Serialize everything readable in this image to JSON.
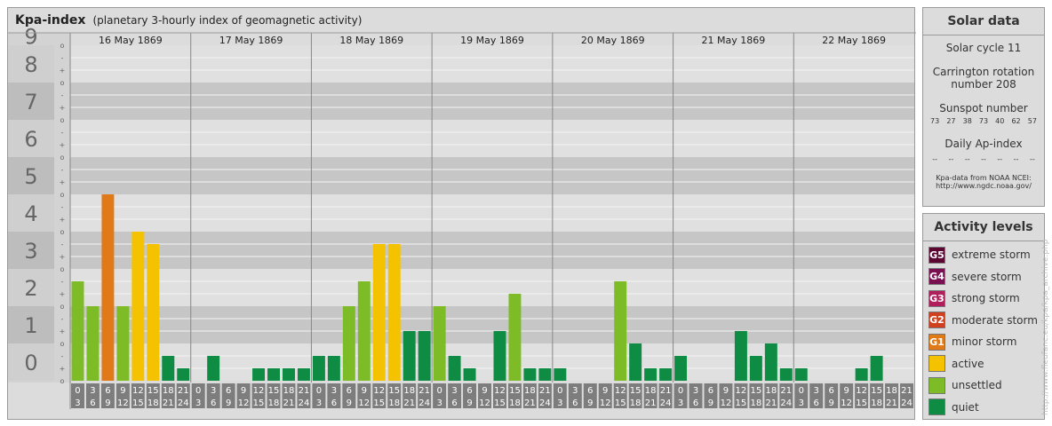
{
  "header": {
    "title": "Kpa-index",
    "subtitle": "(planetary 3-hourly index of geomagnetic activity)"
  },
  "chart_data": {
    "type": "bar",
    "title": "Kpa-index",
    "subtitle": "(planetary 3-hourly index of geomagnetic activity)",
    "ylim": [
      0,
      9
    ],
    "yticks": [
      "0",
      "1",
      "2",
      "3",
      "4",
      "5",
      "6",
      "7",
      "8",
      "9"
    ],
    "minor_ticks": [
      "o",
      "+",
      "-"
    ],
    "days": [
      "16 May 1869",
      "17 May 1869",
      "18 May 1869",
      "19 May 1869",
      "20 May 1869",
      "21 May 1869",
      "22 May 1869"
    ],
    "interval_labels": [
      [
        "0",
        "3"
      ],
      [
        "3",
        "6"
      ],
      [
        "6",
        "9"
      ],
      [
        "9",
        "12"
      ],
      [
        "12",
        "15"
      ],
      [
        "15",
        "18"
      ],
      [
        "18",
        "21"
      ],
      [
        "21",
        "24"
      ]
    ],
    "values": [
      [
        2.667,
        2,
        5,
        2,
        4,
        3.667,
        0.667,
        0.333
      ],
      [
        0,
        0.667,
        0,
        0,
        0.333,
        0.333,
        0.333,
        0.333
      ],
      [
        0.667,
        0.667,
        2,
        2.667,
        3.667,
        3.667,
        1.333,
        1.333
      ],
      [
        2,
        0.667,
        0.333,
        0,
        1.333,
        2.333,
        0.333,
        0.333
      ],
      [
        0.333,
        0,
        0,
        0,
        2.667,
        1,
        0.333,
        0.333
      ],
      [
        0.667,
        0,
        0,
        0,
        1.333,
        0.667,
        1,
        0.333
      ],
      [
        0.333,
        0,
        0,
        0,
        0.333,
        0.667,
        0,
        0
      ]
    ],
    "colors": {
      "quiet": "#0e8c43",
      "unsettled": "#7dbb27",
      "active": "#f5c200",
      "G1": "#e07a18",
      "G2": "#d0401e",
      "G3": "#b01e5c",
      "G4": "#7a0f52",
      "G5": "#5a0630"
    },
    "grid": true
  },
  "solar": {
    "title": "Solar data",
    "cycle": "Solar cycle 11",
    "carrington_line1": "Carrington rotation",
    "carrington_line2": "number 208",
    "sunspot_title": "Sunspot number",
    "sunspots": [
      "73",
      "27",
      "38",
      "73",
      "40",
      "62",
      "57"
    ],
    "ap_title": "Daily Ap-index",
    "ap_values": [
      "--",
      "--",
      "--",
      "--",
      "--",
      "--",
      "--"
    ],
    "source_line1": "Kpa-data from NOAA NCEI:",
    "source_line2": "http://www.ngdc.noaa.gov/"
  },
  "activity": {
    "title": "Activity levels",
    "items": [
      {
        "code": "G5",
        "label": "extreme storm",
        "color": "#5a0630"
      },
      {
        "code": "G4",
        "label": "severe storm",
        "color": "#7a0f52"
      },
      {
        "code": "G3",
        "label": "strong storm",
        "color": "#b01e5c"
      },
      {
        "code": "G2",
        "label": "moderate storm",
        "color": "#d0401e"
      },
      {
        "code": "G1",
        "label": "minor storm",
        "color": "#e07a18"
      },
      {
        "code": "",
        "label": "active",
        "color": "#f5c200"
      },
      {
        "code": "",
        "label": "unsettled",
        "color": "#7dbb27"
      },
      {
        "code": "",
        "label": "quiet",
        "color": "#0e8c43"
      }
    ]
  },
  "credit": "http://www.fleufanc.eu/kpa/kpa_archive.php"
}
